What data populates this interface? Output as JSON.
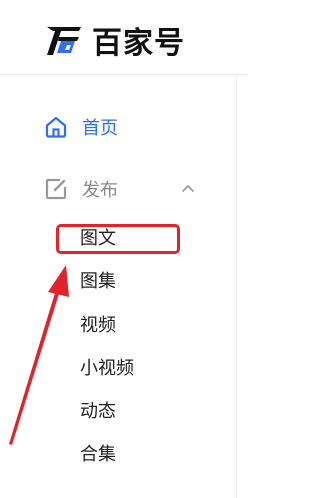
{
  "brand": {
    "name": "百家号"
  },
  "nav": {
    "home": {
      "label": "首页",
      "icon": "home-icon"
    },
    "publish": {
      "label": "发布",
      "icon": "edit-icon",
      "chevron": "chevron-up-icon"
    },
    "publish_items": [
      {
        "label": "图文"
      },
      {
        "label": "图集"
      },
      {
        "label": "视频"
      },
      {
        "label": "小视频"
      },
      {
        "label": "动态"
      },
      {
        "label": "合集"
      }
    ]
  },
  "colors": {
    "accent": "#2f6ff5",
    "annotation": "#e0242a"
  }
}
